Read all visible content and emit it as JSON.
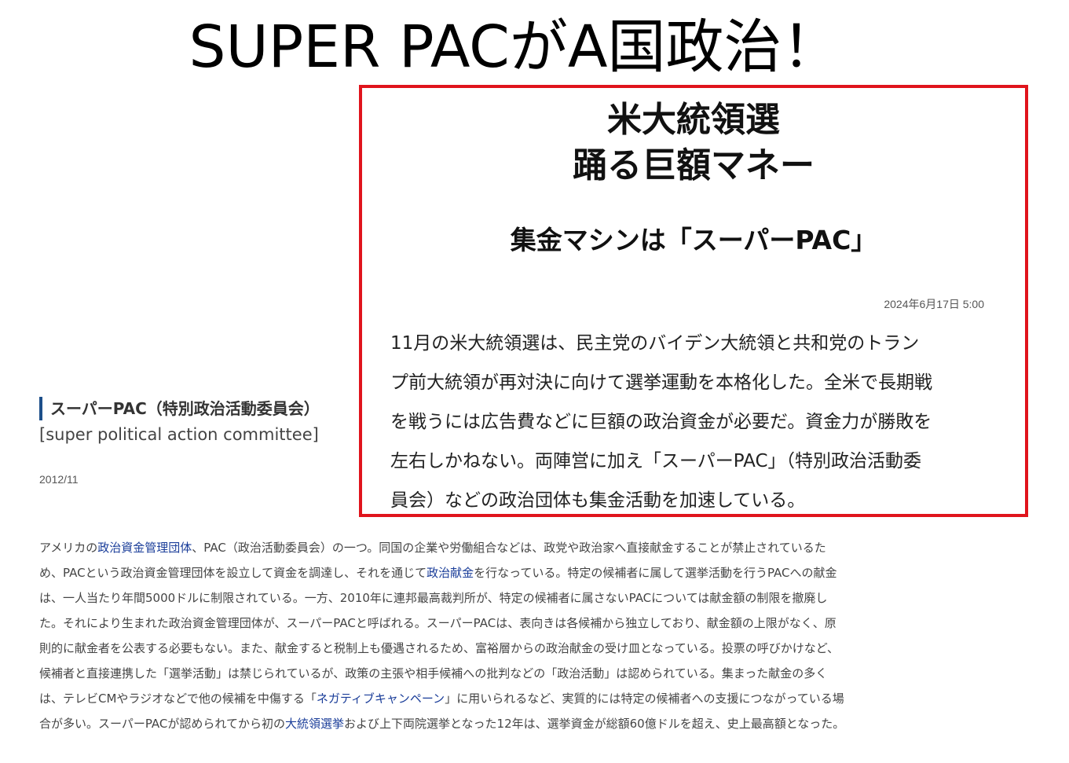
{
  "main_title": "SUPER PACがA国政治！",
  "article": {
    "headline_line1": "米大統領選",
    "headline_line2": "踊る巨額マネー",
    "subhead": "集金マシンは「スーパーPAC」",
    "date": "2024年6月17日 5:00",
    "body_lines": [
      "11月の米大統領選は、民主党のバイデン大統領と共和党のトラン",
      "プ前大統領が再対決に向けて選挙運動を本格化した。全米で長期戦",
      "を戦うには広告費などに巨額の政治資金が必要だ。資金力が勝敗を",
      "左右しかねない。両陣営に加え「スーパーPAC」（特別政治活動委",
      "員会）などの政治団体も集金活動を加速している。"
    ]
  },
  "glossary": {
    "term": "スーパーPAC（特別政治活動委員会）",
    "reading": "[super political action committee]",
    "date": "2012/11",
    "body": {
      "l1_a": "アメリカの",
      "l1_link": "政治資金管理団体",
      "l1_b": "、PAC（政治活動委員会）の一つ。同国の企業や労働組合などは、政党や政治家へ直接献金することが禁止されているた",
      "l2_a": "め、PACという政治資金管理団体を設立して資金を調達し、それを通じて",
      "l2_link": "政治献金",
      "l2_b": "を行なっている。特定の候補者に属して選挙活動を行うPACへの献金",
      "l3": "は、一人当たり年間5000ドルに制限されている。一方、2010年に連邦最高裁判所が、特定の候補者に属さないPACについては献金額の制限を撤廃し",
      "l4": "た。それにより生まれた政治資金管理団体が、スーパーPACと呼ばれる。スーパーPACは、表向きは各候補から独立しており、献金額の上限がなく、原",
      "l5": "則的に献金者を公表する必要もない。また、献金すると税制上も優遇されるため、富裕層からの政治献金の受け皿となっている。投票の呼びかけなど、",
      "l6": "候補者と直接連携した「選挙活動」は禁じられているが、政策の主張や相手候補への批判などの「政治活動」は認められている。集まった献金の多く",
      "l7_a": "は、テレビCMやラジオなどで他の候補を中傷する「",
      "l7_link": "ネガティブキャンペーン",
      "l7_b": "」に用いられるなど、実質的には特定の候補者への支援につながっている場",
      "l8_a": "合が多い。スーパーPACが認められてから初の",
      "l8_link": "大統領選挙",
      "l8_b": "および上下両院選挙となった12年は、選挙資金が総額60億ドルを超え、史上最高額となった。"
    }
  },
  "colors": {
    "highlight_border": "#e0141c",
    "heading_bar": "#1d4f8a",
    "link": "#1a3d99"
  }
}
